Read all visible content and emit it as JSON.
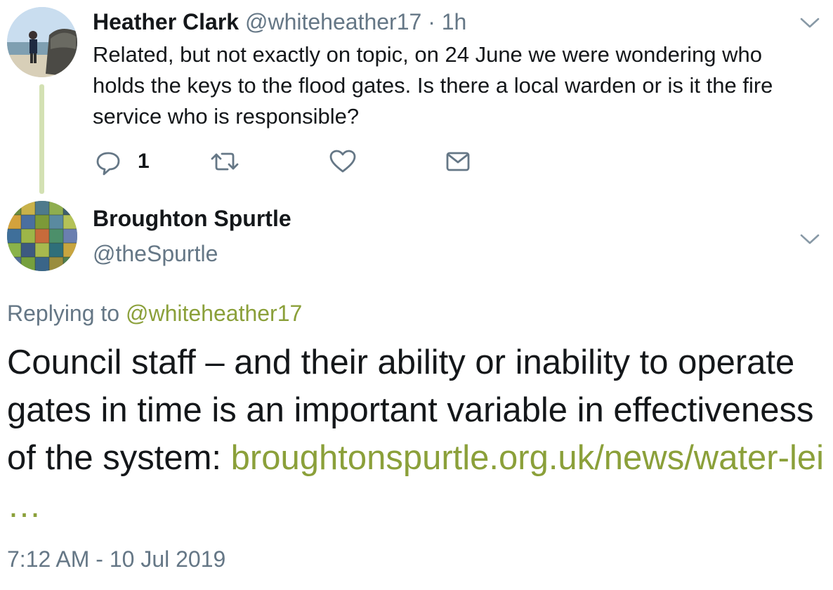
{
  "parent_tweet": {
    "author_name": "Heather Clark",
    "author_handle": "@whiteheather17",
    "separator": "·",
    "time_ago": "1h",
    "text": "Related, but not exactly on topic, on 24 June we were wondering who holds the keys to the flood gates. Is there a local warden or is it the fire service who is responsible?",
    "reply_count": "1",
    "icons": [
      "reply-icon",
      "retweet-icon",
      "like-icon",
      "direct-message-icon",
      "chevron-down-icon"
    ]
  },
  "reply_tweet": {
    "author_name": "Broughton Spurtle",
    "author_handle": "@theSpurtle",
    "replying_prefix": "Replying to",
    "replying_mention": "@whiteheather17",
    "text": "Council staff – and their ability or inability to operate gates in time is an important variable in effectiveness of the system: ",
    "link_text": "broughtonspurtle.org.uk/news/water-lei …",
    "timestamp": "7:12 AM - 10 Jul 2019"
  },
  "colors": {
    "accent_link": "#8ba03a",
    "secondary_text": "#657786",
    "thread_line": "#d3e1b3",
    "primary_text": "#14171a"
  }
}
